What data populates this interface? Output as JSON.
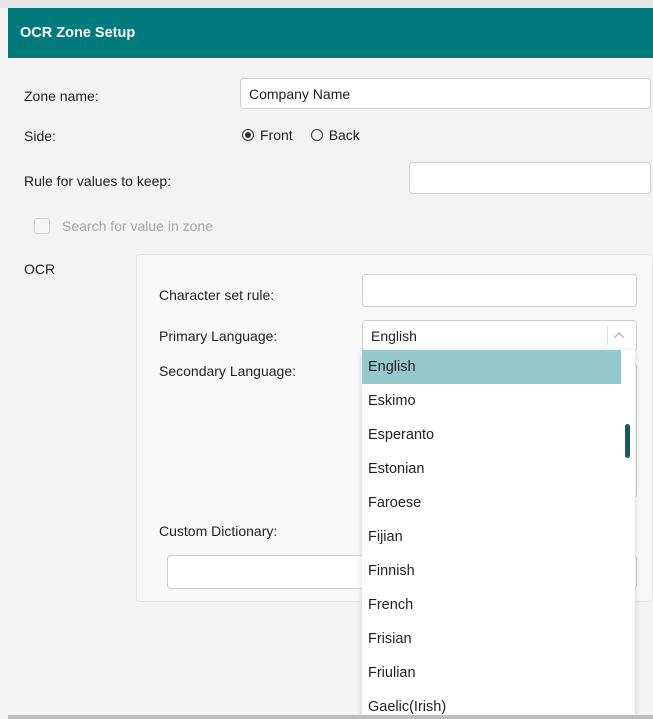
{
  "window": {
    "title": "OCR Zone Setup"
  },
  "form": {
    "zone_name_label": "Zone name:",
    "zone_name_value": "Company Name",
    "side_label": "Side:",
    "side_options": [
      "Front",
      "Back"
    ],
    "side_selected": "Front",
    "rule_label": "Rule for values to keep:",
    "rule_value": "",
    "search_checkbox_label": "Search for value in zone",
    "ocr_label": "OCR"
  },
  "ocr": {
    "char_set_label": "Character set rule:",
    "char_set_value": "",
    "primary_label": "Primary Language:",
    "primary_value": "English",
    "secondary_label": "Secondary Language:",
    "custom_dict_label": "Custom Dictionary:",
    "custom_dict_value": ""
  },
  "dropdown": {
    "options": [
      "English",
      "Eskimo",
      "Esperanto",
      "Estonian",
      "Faroese",
      "Fijian",
      "Finnish",
      "French",
      "Frisian",
      "Friulian",
      "Gaelic(Irish)"
    ],
    "selected": "English"
  },
  "icons": {
    "dropdown_toggle": "chevron-up-icon"
  },
  "colors": {
    "titlebar": "#007a7d",
    "selected_item": "#96c9cc",
    "scroll_thumb": "#0b5f62"
  }
}
